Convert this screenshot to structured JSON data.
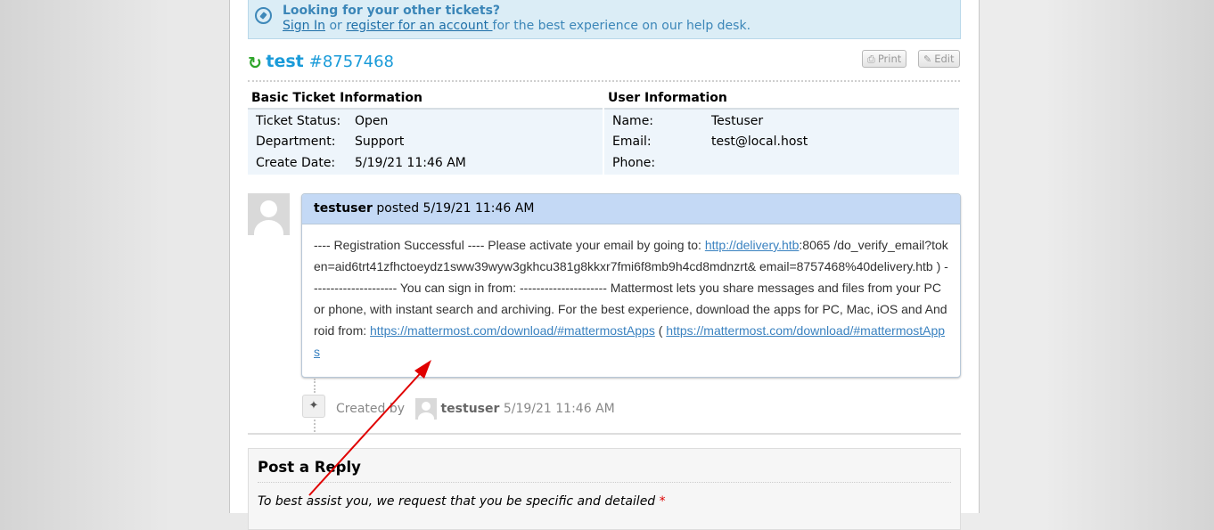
{
  "notice": {
    "heading": "Looking for your other tickets?",
    "sign_in": "Sign In",
    "or": " or ",
    "register": "register for an account ",
    "suffix": "for the best experience on our help desk."
  },
  "ticket": {
    "subject": "test",
    "number": "#8757468",
    "print_label": "Print",
    "edit_label": "Edit"
  },
  "basic_info": {
    "heading": "Basic Ticket Information",
    "rows": [
      {
        "label": "Ticket Status:",
        "value": "Open"
      },
      {
        "label": "Department:",
        "value": "Support"
      },
      {
        "label": "Create Date:",
        "value": "5/19/21 11:46 AM"
      }
    ]
  },
  "user_info": {
    "heading": "User Information",
    "rows": [
      {
        "label": "Name:",
        "value": "Testuser"
      },
      {
        "label": "Email:",
        "value": "test@local.host"
      },
      {
        "label": "Phone:",
        "value": ""
      }
    ]
  },
  "thread": {
    "poster": "testuser",
    "posted_text": " posted 5/19/21 11:46 AM",
    "body_part1": "---- Registration Successful ---- Please activate your email by going to: ",
    "link1": "http://delivery.htb",
    "body_part2": ":8065 /do_verify_email?token=aid6trt41zfhctoeydz1sww39wyw3gkhcu381g8kkxr7fmi6f8mb9h4cd8mdnzrt& email=8757468%40delivery.htb ) --------------------- You can sign in from: --------------------- Mattermost lets you share messages and files from your PC or phone, with instant search and archiving. For the best experience, download the apps for PC, Mac, iOS and Android from: ",
    "link2": "https://mattermost.com/download/#mattermostApps",
    "body_part3": " ( ",
    "link3": "https://mattermost.com/download/#mattermostApps"
  },
  "event": {
    "created_by": "Created by ",
    "user": "testuser",
    "time": " 5/19/21 11:46 AM"
  },
  "reply": {
    "heading": "Post a Reply",
    "instruction": "To best assist you, we request that you be specific and detailed",
    "required_mark": " *"
  },
  "colors": {
    "accent": "#1a9bd9",
    "notice_bg": "#dbedf6",
    "thread_header": "#c4d9f5",
    "annotation_arrow": "#e00000"
  }
}
